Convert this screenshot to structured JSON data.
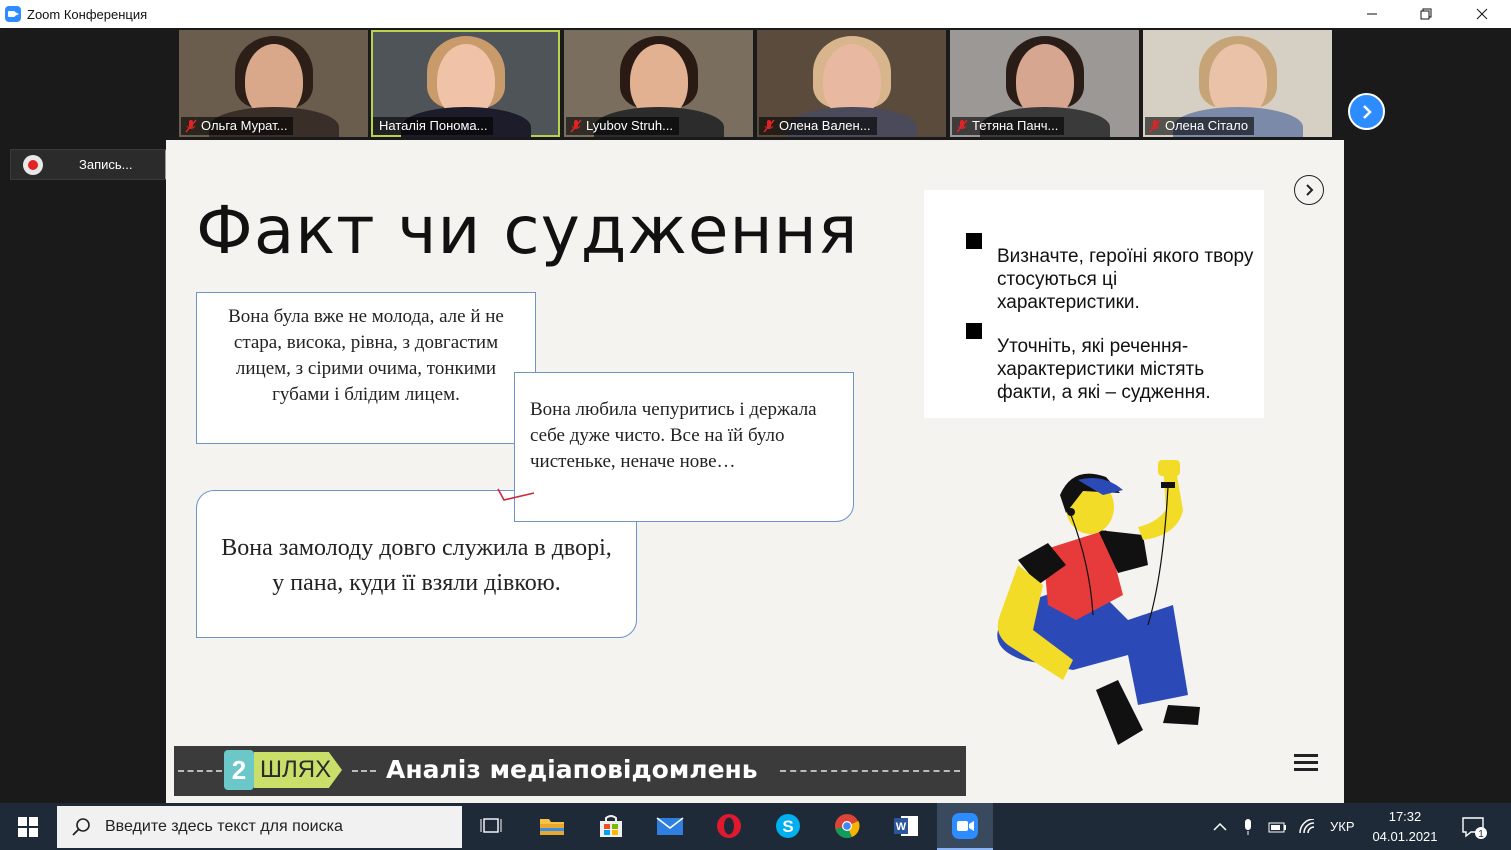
{
  "window": {
    "title": "Zoom Конференция",
    "minimize": "—",
    "restore": "❐",
    "close": "✕"
  },
  "participants": [
    {
      "name": "Ольга Мурат...",
      "bg": "#6b5d4e",
      "skin": "#d9a88a",
      "hair": "#2c1f18",
      "shirt": "#3a2e28"
    },
    {
      "name": "Наталія Понома...",
      "bg": "#4e5458",
      "skin": "#f0c3a8",
      "hair": "#c99a6a",
      "shirt": "#1c1c2a"
    },
    {
      "name": "Lyubov Struh...",
      "bg": "#7a6f5e",
      "skin": "#e1b192",
      "hair": "#2a1a14",
      "shirt": "#2c2c2c"
    },
    {
      "name": "Олена Вален...",
      "bg": "#5b4b3c",
      "skin": "#e8b9a0",
      "hair": "#d8b58c",
      "shirt": "#4a4a5a"
    },
    {
      "name": "Тетяна Панч...",
      "bg": "#9c9895",
      "skin": "#d7a690",
      "hair": "#2a1c16",
      "shirt": "#3a3a3a"
    },
    {
      "name": "Олена Сітало",
      "bg": "#d5cfc4",
      "skin": "#e9c2a8",
      "hair": "#c6a477",
      "shirt": "#7b8aa8"
    }
  ],
  "recording": {
    "label": "Запись..."
  },
  "slide": {
    "title": "Факт чи судження",
    "box1": "Вона була вже не молода, але й не стара, висока, рівна, з довгастим лицем, з сірими очима,  тонкими губами і блідим лицем.",
    "box2": "Вона любила чепуритись і держала себе дуже чисто. Все на їй було чистеньке, неначе нове…",
    "box3": "Вона замолоду довго служила в дворі, у пана, куди її взяли дівкою.",
    "bullets": [
      "Визначте, героїні якого твору стосуються ці характеристики.",
      "Уточніть, які речення-характеристики  містять факти, а які – судження."
    ],
    "banner": {
      "number": "2",
      "word": "ШЛЯХ",
      "caption": "Аналіз медіаповідомлень"
    }
  },
  "taskbar": {
    "search_placeholder": "Введите здесь текст для поиска",
    "language": "УКР",
    "time": "17:32",
    "date": "04.01.2021",
    "notifications": "1"
  },
  "colors": {
    "zoom_blue": "#2d8cff",
    "active_speaker": "#b8d24a",
    "recording_red": "#e02424"
  }
}
